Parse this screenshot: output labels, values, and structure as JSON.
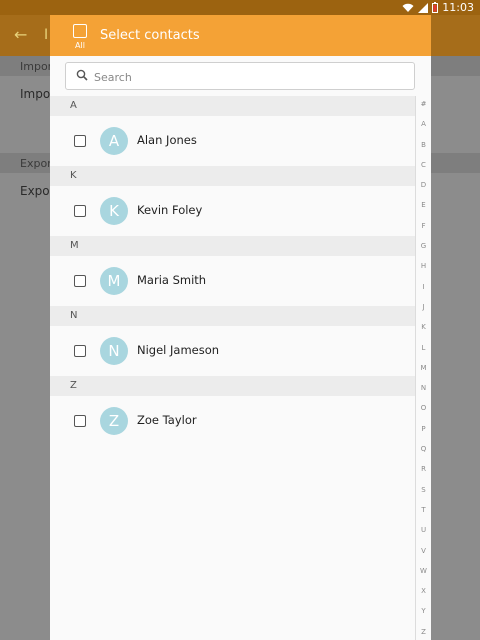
{
  "status_bar": {
    "time": "11:03"
  },
  "background": {
    "title": "I",
    "sections": [
      {
        "header": "Import",
        "item": "Import"
      },
      {
        "header": "Export",
        "item": "Export"
      }
    ]
  },
  "dialog": {
    "all_label": "All",
    "title": "Select contacts",
    "search_placeholder": "Search",
    "groups": [
      {
        "letter": "A",
        "contacts": [
          {
            "initial": "A",
            "name": "Alan Jones"
          }
        ]
      },
      {
        "letter": "K",
        "contacts": [
          {
            "initial": "K",
            "name": "Kevin Foley"
          }
        ]
      },
      {
        "letter": "M",
        "contacts": [
          {
            "initial": "M",
            "name": "Maria Smith"
          }
        ]
      },
      {
        "letter": "N",
        "contacts": [
          {
            "initial": "N",
            "name": "Nigel Jameson"
          }
        ]
      },
      {
        "letter": "Z",
        "contacts": [
          {
            "initial": "Z",
            "name": "Zoe Taylor"
          }
        ]
      }
    ],
    "index": [
      "#",
      "A",
      "B",
      "C",
      "D",
      "E",
      "F",
      "G",
      "H",
      "I",
      "J",
      "K",
      "L",
      "M",
      "N",
      "O",
      "P",
      "Q",
      "R",
      "S",
      "T",
      "U",
      "V",
      "W",
      "X",
      "Y",
      "Z"
    ]
  },
  "colors": {
    "header": "#f4a236",
    "avatar": "#a9d6df",
    "statusbar": "#9c6310"
  }
}
